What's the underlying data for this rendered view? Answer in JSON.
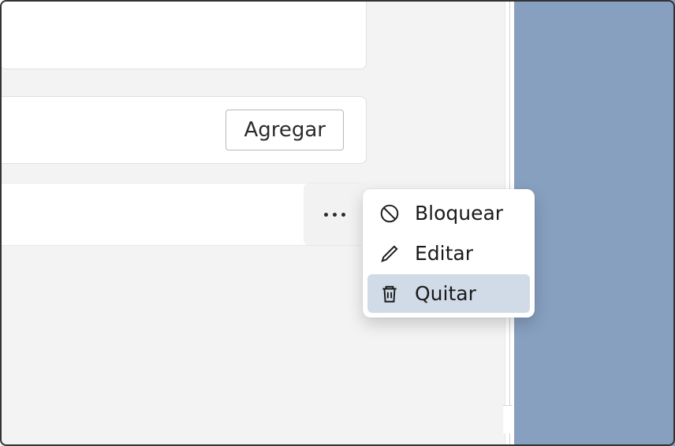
{
  "add_button": {
    "label": "Agregar"
  },
  "context_menu": {
    "items": [
      {
        "label": "Bloquear",
        "icon": "block"
      },
      {
        "label": "Editar",
        "icon": "edit"
      },
      {
        "label": "Quitar",
        "icon": "trash",
        "highlighted": true
      }
    ]
  }
}
